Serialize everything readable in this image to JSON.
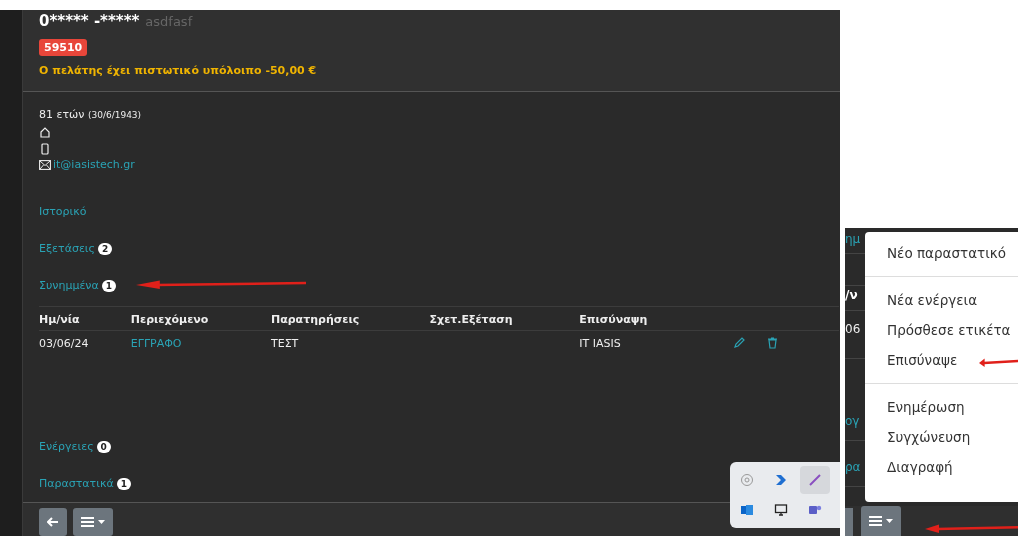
{
  "customer": {
    "name": "0***** -*****",
    "alias": "asdfasf",
    "code_badge": "59510",
    "balance_warning": "Ο πελάτης έχει πιστωτικό υπόλοιπο -50,00 €"
  },
  "details": {
    "age": "81 ετών",
    "birth_date": "(30/6/1943)",
    "email": "it@iasistech.gr"
  },
  "sections": [
    {
      "label": "Ιστορικό"
    },
    {
      "label": "Εξετάσεις",
      "count": "2"
    },
    {
      "label": "Συνημμένα",
      "count": "1",
      "table": {
        "columns": [
          "Ημ/νία",
          "Περιεχόμενο",
          "Παρατηρήσεις",
          "Σχετ.Εξέταση",
          "Επισύναψη"
        ],
        "rows": [
          {
            "date": "03/06/24",
            "content": "ΕΓΓΡΑΦΟ",
            "notes": "ΤΕΣΤ",
            "attached_by": "IT IASIS"
          }
        ]
      }
    },
    {
      "label": "Ενέργειες",
      "count": "0"
    },
    {
      "label": "Παραστατικά",
      "count": "1"
    }
  ],
  "side_fragments": [
    {
      "text": "ημ",
      "kind": "link"
    },
    {
      "text": "/ν",
      "kind": "header"
    },
    {
      "text": "06",
      "kind": "cell"
    },
    {
      "text": "ογ",
      "kind": "link"
    },
    {
      "text": "ρα",
      "kind": "link"
    }
  ],
  "menu": {
    "groups": [
      [
        "Νέο παραστατικό"
      ],
      [
        "Νέα ενέργεια",
        "Πρόσθεσε ετικέτα",
        "Επισύναψε"
      ],
      [
        "Ενημέρωση",
        "Συγχώνευση",
        "Διαγραφή"
      ]
    ]
  }
}
